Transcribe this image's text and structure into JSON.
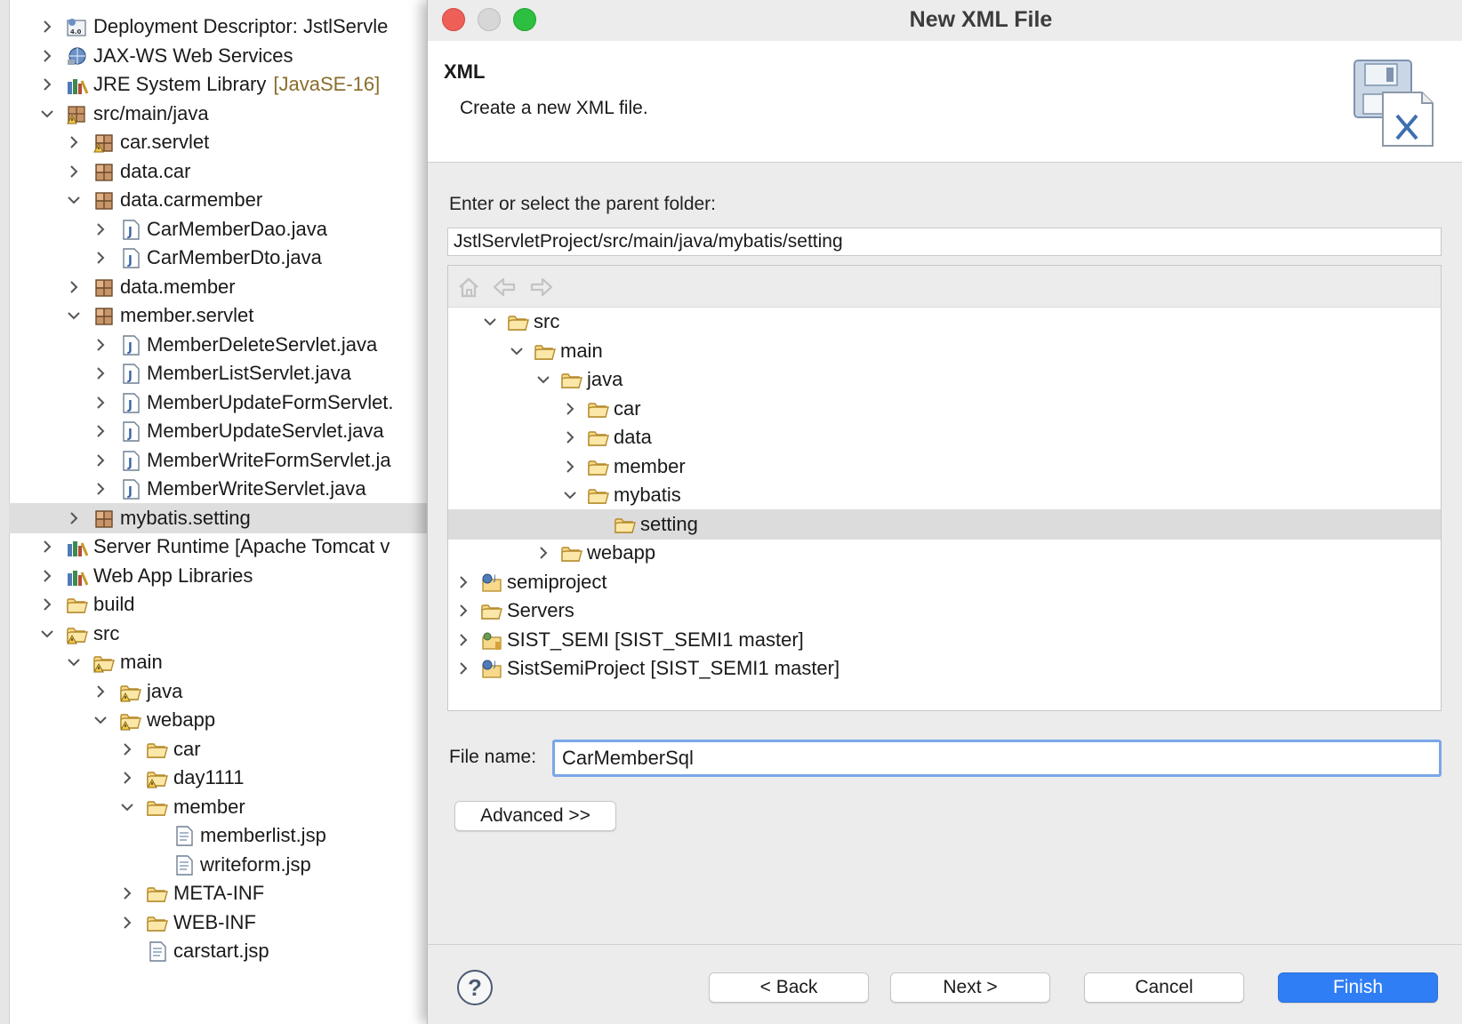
{
  "colors": {
    "selection": "#dcdcdc",
    "accent": "#2f7ef5",
    "decoration": "#8a6d2b",
    "focus": "#7aa7e8"
  },
  "explorer": {
    "items": [
      {
        "label": "Deployment Descriptor: JstlServle",
        "icon": "deployment-descriptor-icon",
        "depth": 1,
        "toggle": "collapsed"
      },
      {
        "label": "JAX-WS Web Services",
        "icon": "web-services-icon",
        "depth": 1,
        "toggle": "collapsed"
      },
      {
        "label": "JRE System Library",
        "decoration": "[JavaSE-16]",
        "icon": "library-icon",
        "depth": 1,
        "toggle": "collapsed"
      },
      {
        "label": "src/main/java",
        "icon": "source-folder-icon",
        "depth": 1,
        "toggle": "expanded"
      },
      {
        "label": "car.servlet",
        "icon": "package-warning-icon",
        "depth": 2,
        "toggle": "collapsed"
      },
      {
        "label": "data.car",
        "icon": "package-icon",
        "depth": 2,
        "toggle": "collapsed"
      },
      {
        "label": "data.carmember",
        "icon": "package-icon",
        "depth": 2,
        "toggle": "expanded"
      },
      {
        "label": "CarMemberDao.java",
        "icon": "java-file-icon",
        "depth": 3,
        "toggle": "collapsed"
      },
      {
        "label": "CarMemberDto.java",
        "icon": "java-file-icon",
        "depth": 3,
        "toggle": "collapsed"
      },
      {
        "label": "data.member",
        "icon": "package-icon",
        "depth": 2,
        "toggle": "collapsed"
      },
      {
        "label": "member.servlet",
        "icon": "package-icon",
        "depth": 2,
        "toggle": "expanded"
      },
      {
        "label": "MemberDeleteServlet.java",
        "icon": "java-file-icon",
        "depth": 3,
        "toggle": "collapsed"
      },
      {
        "label": "MemberListServlet.java",
        "icon": "java-file-icon",
        "depth": 3,
        "toggle": "collapsed"
      },
      {
        "label": "MemberUpdateFormServlet.",
        "icon": "java-file-icon",
        "depth": 3,
        "toggle": "collapsed"
      },
      {
        "label": "MemberUpdateServlet.java",
        "icon": "java-file-icon",
        "depth": 3,
        "toggle": "collapsed"
      },
      {
        "label": "MemberWriteFormServlet.ja",
        "icon": "java-file-icon",
        "depth": 3,
        "toggle": "collapsed"
      },
      {
        "label": "MemberWriteServlet.java",
        "icon": "java-file-icon",
        "depth": 3,
        "toggle": "collapsed"
      },
      {
        "label": "mybatis.setting",
        "icon": "package-icon",
        "depth": 2,
        "toggle": "collapsed",
        "selected": true
      },
      {
        "label": "Server Runtime [Apache Tomcat v",
        "icon": "library-icon",
        "depth": 1,
        "toggle": "collapsed"
      },
      {
        "label": "Web App Libraries",
        "icon": "library-icon",
        "depth": 1,
        "toggle": "collapsed"
      },
      {
        "label": "build",
        "icon": "folder-icon",
        "depth": 1,
        "toggle": "collapsed"
      },
      {
        "label": "src",
        "icon": "folder-warning-icon",
        "depth": 1,
        "toggle": "expanded"
      },
      {
        "label": "main",
        "icon": "folder-warning-icon",
        "depth": 2,
        "toggle": "expanded"
      },
      {
        "label": "java",
        "icon": "folder-warning-icon",
        "depth": 3,
        "toggle": "collapsed"
      },
      {
        "label": "webapp",
        "icon": "folder-warning-icon",
        "depth": 3,
        "toggle": "expanded"
      },
      {
        "label": "car",
        "icon": "folder-icon",
        "depth": 4,
        "toggle": "collapsed"
      },
      {
        "label": "day1111",
        "icon": "folder-warning-icon",
        "depth": 4,
        "toggle": "collapsed"
      },
      {
        "label": "member",
        "icon": "folder-icon",
        "depth": 4,
        "toggle": "expanded"
      },
      {
        "label": "memberlist.jsp",
        "icon": "jsp-file-icon",
        "depth": 5,
        "toggle": "none"
      },
      {
        "label": "writeform.jsp",
        "icon": "jsp-file-icon",
        "depth": 5,
        "toggle": "none"
      },
      {
        "label": "META-INF",
        "icon": "folder-icon",
        "depth": 4,
        "toggle": "collapsed"
      },
      {
        "label": "WEB-INF",
        "icon": "folder-icon",
        "depth": 4,
        "toggle": "collapsed"
      },
      {
        "label": "carstart.jsp",
        "icon": "jsp-file-icon",
        "depth": 4,
        "toggle": "none"
      }
    ]
  },
  "dialog": {
    "title": "New XML File",
    "header": {
      "title": "XML",
      "description": "Create a new XML file."
    },
    "parent_label": "Enter or select the parent folder:",
    "parent_value": "JstlServletProject/src/main/java/mybatis/setting",
    "tree": [
      {
        "label": "src",
        "icon": "folder-icon",
        "depth": 1,
        "toggle": "expanded"
      },
      {
        "label": "main",
        "icon": "folder-icon",
        "depth": 2,
        "toggle": "expanded"
      },
      {
        "label": "java",
        "icon": "folder-icon",
        "depth": 3,
        "toggle": "expanded"
      },
      {
        "label": "car",
        "icon": "folder-icon",
        "depth": 4,
        "toggle": "collapsed"
      },
      {
        "label": "data",
        "icon": "folder-icon",
        "depth": 4,
        "toggle": "collapsed"
      },
      {
        "label": "member",
        "icon": "folder-icon",
        "depth": 4,
        "toggle": "collapsed"
      },
      {
        "label": "mybatis",
        "icon": "folder-icon",
        "depth": 4,
        "toggle": "expanded"
      },
      {
        "label": "setting",
        "icon": "folder-icon",
        "depth": 5,
        "toggle": "none",
        "selected": true
      },
      {
        "label": "webapp",
        "icon": "folder-icon",
        "depth": 3,
        "toggle": "collapsed"
      },
      {
        "label": "semiproject",
        "icon": "web-project-icon",
        "depth": 0,
        "toggle": "collapsed"
      },
      {
        "label": "Servers",
        "icon": "folder-icon",
        "depth": 0,
        "toggle": "collapsed"
      },
      {
        "label": "SIST_SEMI [SIST_SEMI1 master]",
        "icon": "git-project-icon",
        "depth": 0,
        "toggle": "collapsed"
      },
      {
        "label": "SistSemiProject [SIST_SEMI1 master]",
        "icon": "web-project-icon",
        "depth": 0,
        "toggle": "collapsed"
      }
    ],
    "file_name_label": "File name:",
    "file_name_value": "CarMemberSql",
    "advanced_label": "Advanced >>",
    "help_label": "?",
    "back_label": "< Back",
    "next_label": "Next >",
    "cancel_label": "Cancel",
    "finish_label": "Finish"
  }
}
